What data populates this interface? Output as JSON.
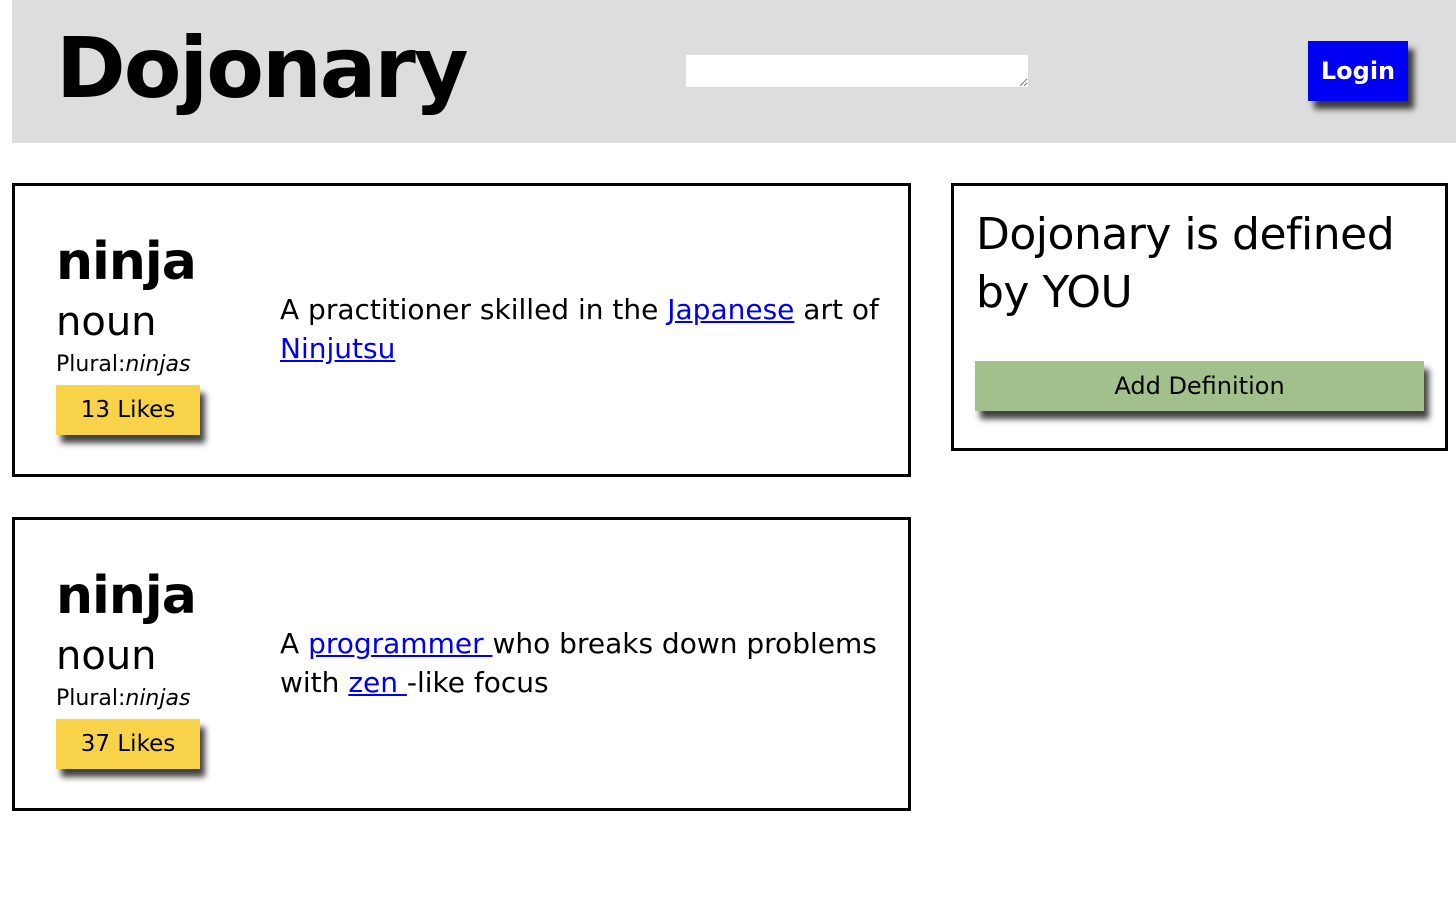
{
  "header": {
    "logo": "Dojonary",
    "search": {
      "value": "",
      "placeholder": ""
    },
    "login_label": "Login"
  },
  "entries": [
    {
      "word": "ninja",
      "part_of_speech": "noun",
      "plural_label": "Plural:",
      "plural": "ninjas",
      "likes_label": "13 Likes",
      "definition": {
        "t1": "A practitioner skilled in the ",
        "link1": "Japanese",
        "t2": " art of ",
        "link2": "Ninjutsu",
        "t3": ""
      }
    },
    {
      "word": "ninja",
      "part_of_speech": "noun",
      "plural_label": "Plural:",
      "plural": "ninjas",
      "likes_label": "37 Likes",
      "definition": {
        "t1": "A ",
        "link1": "programmer ",
        "t2": "who breaks down problems with ",
        "link2": "zen ",
        "t3": "-like focus"
      }
    }
  ],
  "sidebar": {
    "title": "Dojonary is defined by YOU",
    "add_definition_label": "Add Definition"
  },
  "colors": {
    "header_bg": "#dddddd",
    "login_bg": "#0000f2",
    "likes_bg": "#f8d34a",
    "add_definition_bg": "#a1c08b",
    "link": "#0000ee"
  }
}
